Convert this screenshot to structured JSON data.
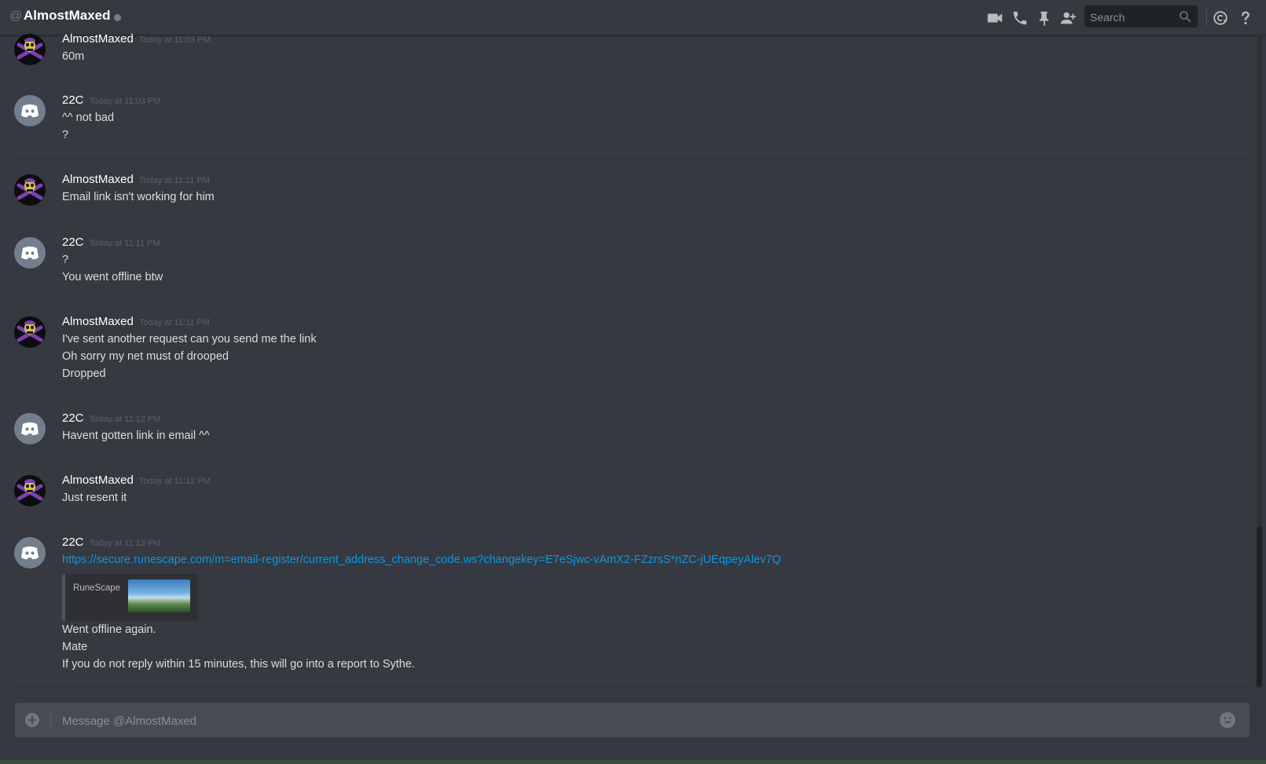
{
  "header": {
    "at_symbol": "@",
    "title": "AlmostMaxed",
    "search_placeholder": "Search"
  },
  "icons": {
    "video": "video-camera-icon",
    "call": "phone-icon",
    "pin": "pin-icon",
    "add_friend": "add-friend-icon",
    "search": "search-icon",
    "mentions": "mention-icon",
    "help": "help-icon",
    "attach": "plus-icon",
    "emoji": "emoji-icon"
  },
  "colors": {
    "background": "#36393f",
    "link": "#0b96e6",
    "username": "#ffffff",
    "timestamp": "#5d6168"
  },
  "messages": [
    {
      "author": "AlmostMaxed",
      "time": "Today at 11:03 PM",
      "lines": [
        "60m"
      ]
    },
    {
      "author": "22C",
      "time": "Today at 11:03 PM",
      "lines": [
        "^^ not bad",
        "?"
      ]
    },
    {
      "author": "AlmostMaxed",
      "time": "Today at 11:11 PM",
      "lines": [
        "Email link isn't working for him"
      ]
    },
    {
      "author": "22C",
      "time": "Today at 11:11 PM",
      "lines": [
        "?",
        "You went offline btw"
      ]
    },
    {
      "author": "AlmostMaxed",
      "time": "Today at 11:11 PM",
      "lines": [
        "I've sent another request can you send me the link",
        "Oh sorry my net must of drooped",
        "Dropped"
      ]
    },
    {
      "author": "22C",
      "time": "Today at 11:12 PM",
      "lines": [
        "Havent gotten link in email ^^"
      ]
    },
    {
      "author": "AlmostMaxed",
      "time": "Today at 11:12 PM",
      "lines": [
        "Just resent it"
      ]
    },
    {
      "author": "22C",
      "time": "Today at 11:13 PM",
      "link": "https://secure.runescape.com/m=email-register/current_address_change_code.ws?changekey=E7eSjwc-vAmX2-FZzrsS*nZC-jUEqpeyAlev7Q",
      "embed_provider": "RuneScape",
      "lines": [
        "Went offline again.",
        "Mate",
        "If you do not reply within 15 minutes, this will go into a report to Sythe."
      ]
    }
  ],
  "composer": {
    "placeholder": "Message @AlmostMaxed"
  }
}
